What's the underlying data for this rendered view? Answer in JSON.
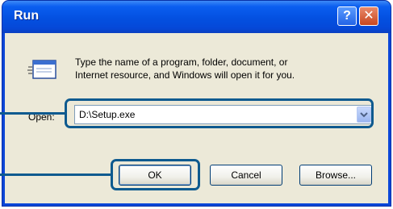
{
  "window": {
    "title": "Run",
    "help_glyph": "?",
    "close_glyph": "✕"
  },
  "dialog": {
    "description_line1": "Type the name of a program, folder, document, or",
    "description_line2": "Internet resource, and Windows will open it for you.",
    "open_label": "Open:",
    "open_value": "D:\\Setup.exe"
  },
  "buttons": {
    "ok": "OK",
    "cancel": "Cancel",
    "browse": "Browse..."
  },
  "icons": {
    "run": "run-program-icon",
    "dropdown": "chevron-down-icon"
  },
  "colors": {
    "titlebar": "#0548d8",
    "client": "#ece9d8",
    "callout": "#0e5a8f"
  }
}
